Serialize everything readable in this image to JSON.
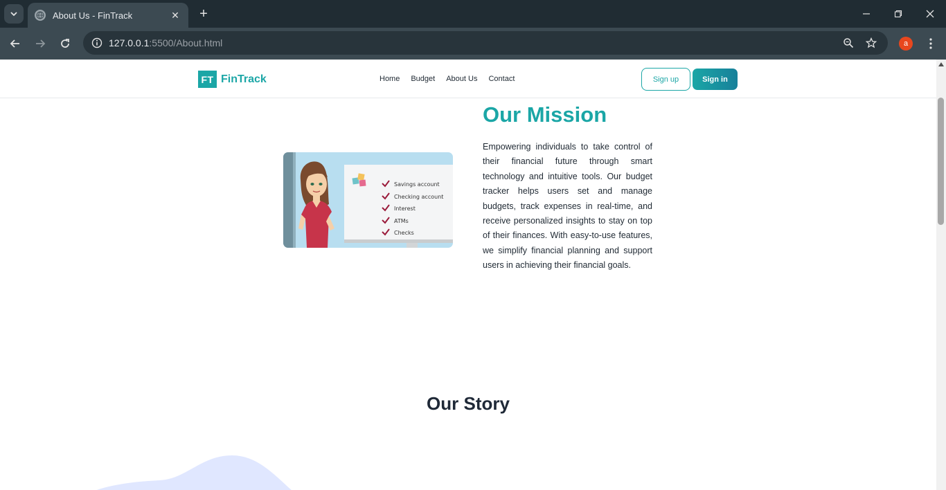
{
  "browser": {
    "tab_title": "About Us - FinTrack",
    "url_host": "127.0.0.1",
    "url_path": ":5500/About.html",
    "profile_initial": "a"
  },
  "site": {
    "logo_badge": "FT",
    "logo_text": "FinTrack",
    "nav": [
      "Home",
      "Budget",
      "About Us",
      "Contact"
    ],
    "signup_label": "Sign up",
    "signin_label": "Sign in"
  },
  "mission": {
    "title": "Our Mission",
    "text": "Empowering individuals to take control of their financial future through smart technology and intuitive tools. Our budget tracker helps users set and manage budgets, track expenses in real-time, and receive personalized insights to stay on top of their finances. With easy-to-use features, we simplify financial planning and support users in achieving their financial goals.",
    "checklist": [
      "Savings account",
      "Checking account",
      "Interest",
      "ATMs",
      "Checks"
    ]
  },
  "story": {
    "title": "Our Story"
  },
  "colors": {
    "brand": "#1ba6a6",
    "brand_dark": "#17809a",
    "heading_dark": "#1f2937",
    "blob": "#e0e7ff"
  }
}
